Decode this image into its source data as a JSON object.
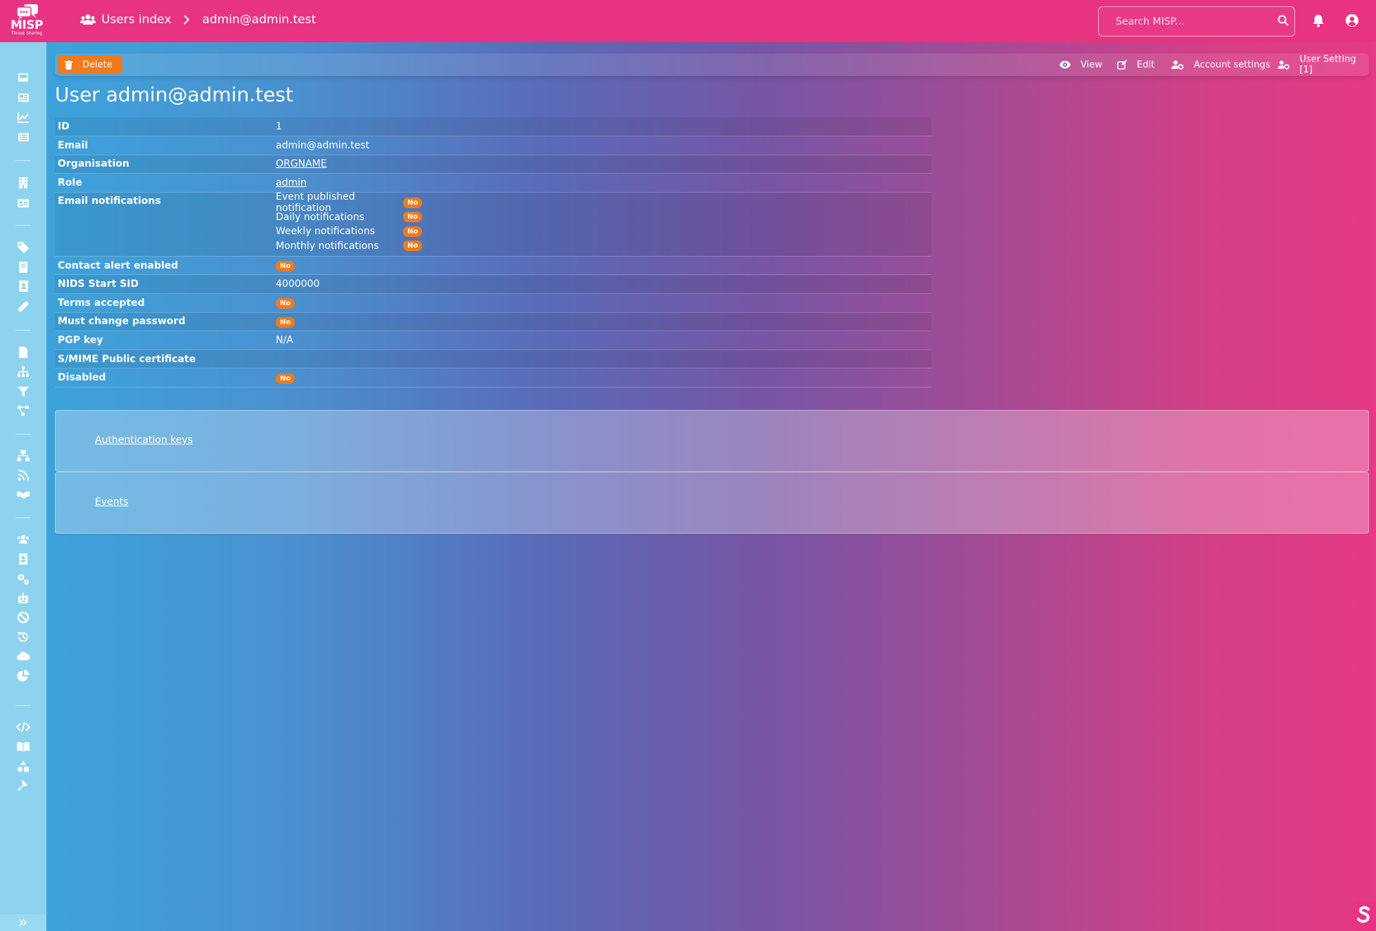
{
  "app": {
    "logo_name": "MISP",
    "logo_sub": "Threat Sharing"
  },
  "breadcrumb": {
    "users_index": "Users index",
    "current": "admin@admin.test"
  },
  "search": {
    "placeholder": "Search MISP..."
  },
  "actions": {
    "delete": "Delete",
    "view": "View",
    "edit": "Edit",
    "account_settings": "Account settings",
    "user_setting": "User Setting [1]"
  },
  "page_title": "User admin@admin.test",
  "details": {
    "id": {
      "label": "ID",
      "value": "1"
    },
    "email": {
      "label": "Email",
      "value": "admin@admin.test"
    },
    "organisation": {
      "label": "Organisation",
      "value": "ORGNAME"
    },
    "role": {
      "label": "Role",
      "value": "admin"
    },
    "email_notifications": {
      "label": "Email notifications",
      "items": [
        {
          "label": "Event published notification",
          "value": "No"
        },
        {
          "label": "Daily notifications",
          "value": "No"
        },
        {
          "label": "Weekly notifications",
          "value": "No"
        },
        {
          "label": "Monthly notifications",
          "value": "No"
        }
      ]
    },
    "contact_alert": {
      "label": "Contact alert enabled",
      "value": "No"
    },
    "nids_sid": {
      "label": "NIDS Start SID",
      "value": "4000000"
    },
    "terms_accepted": {
      "label": "Terms accepted",
      "value": "No"
    },
    "must_change_password": {
      "label": "Must change password",
      "value": "No"
    },
    "pgp_key": {
      "label": "PGP key",
      "value": "N/A"
    },
    "smime": {
      "label": "S/MIME Public certificate",
      "value": ""
    },
    "disabled": {
      "label": "Disabled",
      "value": "No"
    }
  },
  "panels": {
    "auth_keys": "Authentication keys",
    "events": "Events"
  },
  "colors": {
    "topbar": "#e83282",
    "sidebar": "#8dd3f0",
    "badge": "#f07a1c",
    "delete_button": "#f07a1c"
  },
  "sidebar_icons": [
    "inbox-icon",
    "newspaper-icon",
    "chart-line-icon",
    "list-icon",
    "building-icon",
    "id-card-icon",
    "tag-icon",
    "book-icon",
    "address-book-icon",
    "bandage-icon",
    "file-icon",
    "sitemap-icon",
    "filter-icon",
    "project-diagram-icon",
    "network-icon",
    "rss-icon",
    "handshake-icon",
    "users-icon",
    "user-badge-icon",
    "cogs-icon",
    "robot-icon",
    "ban-icon",
    "history-icon",
    "cloud-icon",
    "chart-pie-icon",
    "code-icon",
    "book-open-icon",
    "shapes-icon",
    "hammer-icon"
  ]
}
